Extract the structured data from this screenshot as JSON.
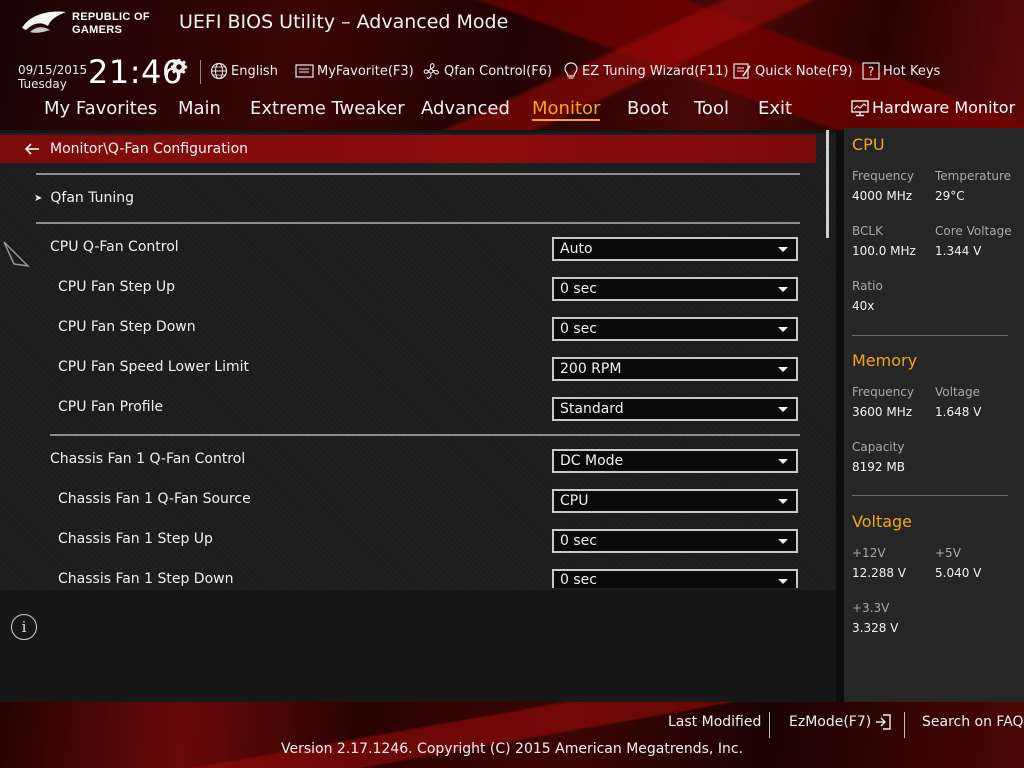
{
  "header": {
    "brand_line1": "REPUBLIC OF",
    "brand_line2": "GAMERS",
    "title": "UEFI BIOS Utility – Advanced Mode"
  },
  "status": {
    "date": "09/15/2015",
    "weekday": "Tuesday",
    "time": "21:46"
  },
  "toolbar": {
    "language": "English",
    "myfavorite": "MyFavorite(F3)",
    "qfan": "Qfan Control(F6)",
    "ez_tuning": "EZ Tuning Wizard(F11)",
    "quick_note": "Quick Note(F9)",
    "hot_keys": "Hot Keys"
  },
  "menu": {
    "tabs": [
      "My Favorites",
      "Main",
      "Extreme Tweaker",
      "Advanced",
      "Monitor",
      "Boot",
      "Tool",
      "Exit"
    ],
    "active": "Monitor"
  },
  "breadcrumb": "Monitor\\Q-Fan Configuration",
  "submenu": {
    "qfan_tuning": "Qfan Tuning"
  },
  "settings": [
    {
      "label": "CPU Q-Fan Control",
      "value": "Auto"
    },
    {
      "label": "CPU Fan Step Up",
      "value": "0 sec"
    },
    {
      "label": "CPU Fan Step Down",
      "value": "0 sec"
    },
    {
      "label": "CPU Fan Speed Lower Limit",
      "value": "200 RPM"
    },
    {
      "label": "CPU Fan Profile",
      "value": "Standard"
    },
    {
      "label": "Chassis Fan 1 Q-Fan Control",
      "value": "DC Mode"
    },
    {
      "label": "Chassis Fan 1 Q-Fan Source",
      "value": "CPU"
    },
    {
      "label": "Chassis Fan 1 Step Up",
      "value": "0 sec"
    },
    {
      "label": "Chassis Fan 1 Step Down",
      "value": "0 sec"
    }
  ],
  "hardware_monitor": {
    "title": "Hardware Monitor",
    "cpu": {
      "title": "CPU",
      "frequency_label": "Frequency",
      "frequency": "4000 MHz",
      "temperature_label": "Temperature",
      "temperature": "29°C",
      "bclk_label": "BCLK",
      "bclk": "100.0 MHz",
      "core_voltage_label": "Core Voltage",
      "core_voltage": "1.344 V",
      "ratio_label": "Ratio",
      "ratio": "40x"
    },
    "memory": {
      "title": "Memory",
      "frequency_label": "Frequency",
      "frequency": "3600 MHz",
      "voltage_label": "Voltage",
      "voltage": "1.648 V",
      "capacity_label": "Capacity",
      "capacity": "8192 MB"
    },
    "voltage": {
      "title": "Voltage",
      "v12_label": "+12V",
      "v12": "12.288 V",
      "v5_label": "+5V",
      "v5": "5.040 V",
      "v33_label": "+3.3V",
      "v33": "3.328 V"
    }
  },
  "footer": {
    "last_modified": "Last Modified",
    "ezmode": "EzMode(F7)",
    "search_faq": "Search on FAQ",
    "copyright": "Version 2.17.1246. Copyright (C) 2015 American Megatrends, Inc."
  },
  "colors": {
    "accent": "#f2a51c",
    "breadcrumb_bar": "#8f0d0d",
    "panel": "#1c1c1c"
  },
  "icons": {
    "settings": "gear-icon",
    "language": "globe-icon",
    "favorite": "favorite-icon",
    "qfan": "fan-icon",
    "ez_tuning": "lightbulb-icon",
    "quick_note": "note-icon",
    "hot_keys": "help-icon",
    "monitor": "monitor-icon",
    "back": "back-arrow-icon",
    "info": "info-icon",
    "exit": "exit-icon"
  }
}
